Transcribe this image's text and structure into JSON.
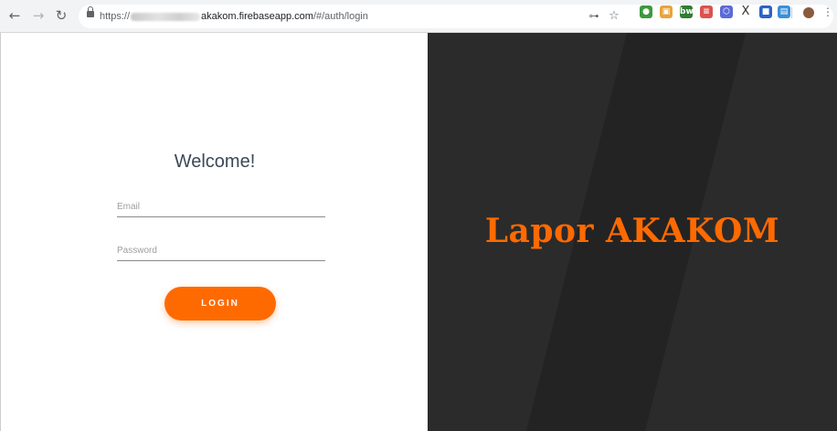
{
  "browser": {
    "url_prefix": "https://",
    "url_host_suffix": "akakom.firebaseapp.com",
    "url_path": "/#/auth/login",
    "icons": {
      "back": "back-arrow-icon",
      "forward": "forward-arrow-icon",
      "reload": "reload-icon",
      "lock": "lock-icon",
      "key": "key-icon",
      "star": "star-icon",
      "menu": "kebab-menu-icon"
    },
    "extensions": [
      {
        "name": "extension-green-icon",
        "glyph": "●",
        "color": "#3c9a3c"
      },
      {
        "name": "extension-multicolor-icon",
        "glyph": "▣",
        "color": "#e8a33c"
      },
      {
        "name": "extension-bw-icon",
        "glyph": "bw",
        "color": "#2f7d32"
      },
      {
        "name": "extension-flag-icon",
        "glyph": "≡",
        "color": "#d9534f"
      },
      {
        "name": "extension-hex-icon",
        "glyph": "⬡",
        "color": "#5b6bd8"
      },
      {
        "name": "extension-x-icon",
        "glyph": "X",
        "color": "#333333"
      },
      {
        "name": "extension-blue-square-icon",
        "glyph": "■",
        "color": "#2b62c7"
      },
      {
        "name": "extension-news-icon",
        "glyph": "▤",
        "color": "#3b8fd8"
      }
    ]
  },
  "login": {
    "title": "Welcome!",
    "email_placeholder": "Email",
    "password_placeholder": "Password",
    "login_label": "LOGIN"
  },
  "brand": {
    "name": "Lapor AKAKOM",
    "accent_color": "#ff6a00",
    "background_color": "#2b2b2b"
  }
}
